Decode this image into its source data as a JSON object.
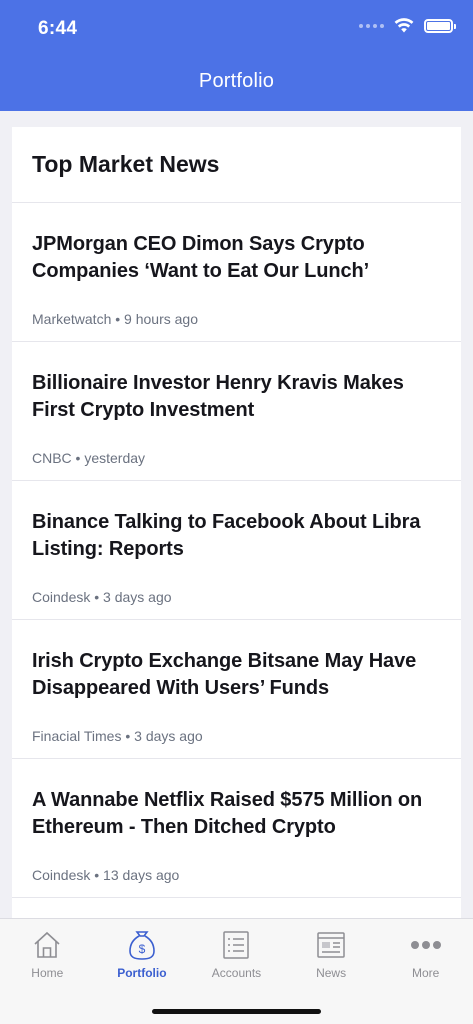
{
  "status_bar": {
    "time": "6:44"
  },
  "header": {
    "title": "Portfolio"
  },
  "news": {
    "section_title": "Top Market News",
    "items": [
      {
        "headline": "JPMorgan CEO Dimon Says Crypto Companies ‘Want to Eat Our Lunch’",
        "meta": "Marketwatch • 9 hours ago"
      },
      {
        "headline": "Billionaire Investor Henry Kravis Makes First Crypto Investment",
        "meta": "CNBC • yesterday"
      },
      {
        "headline": "Binance Talking to Facebook About Libra Listing: Reports",
        "meta": "Coindesk • 3 days ago"
      },
      {
        "headline": "Irish Crypto Exchange Bitsane May Have Disappeared With Users’ Funds",
        "meta": "Finacial Times • 3 days ago"
      },
      {
        "headline": "A Wannabe Netflix Raised $575 Million on Ethereum - Then Ditched Crypto",
        "meta": "Coindesk • 13 days ago"
      }
    ]
  },
  "tabbar": {
    "tabs": [
      {
        "label": "Home",
        "icon": "home-icon"
      },
      {
        "label": "Portfolio",
        "icon": "money-bag-icon",
        "active": true
      },
      {
        "label": "Accounts",
        "icon": "list-icon"
      },
      {
        "label": "News",
        "icon": "newspaper-icon"
      },
      {
        "label": "More",
        "icon": "more-dots-icon"
      }
    ]
  },
  "colors": {
    "brand": "#4c72e6",
    "active_tab": "#3b5fd0",
    "inactive_tab": "#8e8e93"
  }
}
